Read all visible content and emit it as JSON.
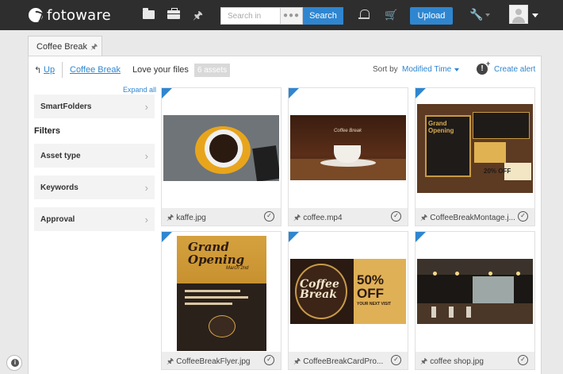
{
  "app": {
    "logo_text": "fotoware"
  },
  "topbar": {
    "search_placeholder": "Search in",
    "search_options": "●●●",
    "search_button": "Search",
    "upload_button": "Upload"
  },
  "tab": {
    "label": "Coffee Break"
  },
  "breadcrumb": {
    "up_arrow": "↰",
    "up_label": "Up",
    "folder": "Coffee Break",
    "current": "Love your files",
    "asset_count": "6 assets"
  },
  "sort": {
    "label": "Sort by",
    "value": "Modified Time"
  },
  "alert": {
    "label": "Create alert"
  },
  "sidebar": {
    "expand_all": "Expand all",
    "smartfolders": "SmartFolders",
    "filters_heading": "Filters",
    "filters": [
      "Asset type",
      "Keywords",
      "Approval"
    ]
  },
  "assets": [
    {
      "filename": "kaffe.jpg"
    },
    {
      "filename": "coffee.mp4"
    },
    {
      "filename": "CoffeeBreakMontage.j..."
    },
    {
      "filename": "CoffeeBreakFlyer.jpg"
    },
    {
      "filename": "CoffeeBreakCardPro..."
    },
    {
      "filename": "coffee shop.jpg"
    }
  ],
  "thumbnails": {
    "mp4_label": "Coffee Break",
    "montage_title": "Grand Opening",
    "montage_percent": "20% OFF",
    "flyer_title": "Grand Opening",
    "flyer_date": "March 2nd",
    "card_title": "Coffee Break",
    "card_offer": "50% OFF",
    "card_visit": "YOUR NEXT VISIT"
  },
  "colors": {
    "accent": "#2f86d0",
    "topbar": "#2e2e2e",
    "badge": "#d9d9d9"
  }
}
